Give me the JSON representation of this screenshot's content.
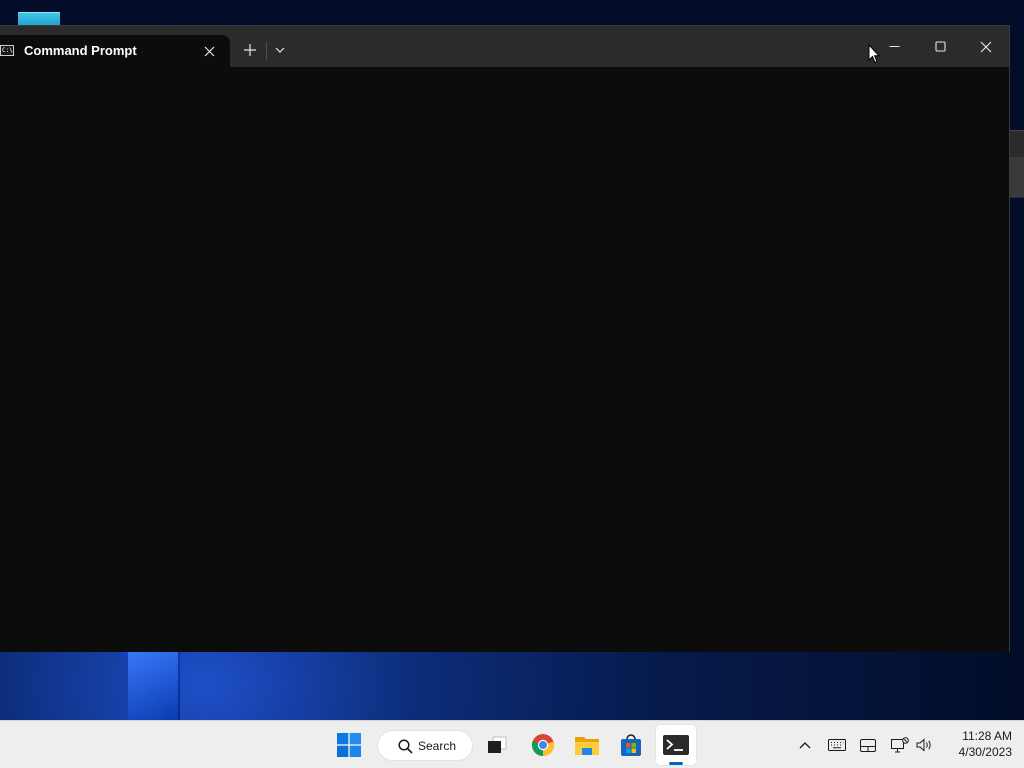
{
  "window": {
    "tab_title": "Command Prompt",
    "tab_icon_text": "C:\\."
  },
  "taskbar": {
    "search_label": "Search",
    "apps": [
      {
        "name": "start",
        "icon": "windows-logo-icon"
      },
      {
        "name": "search",
        "icon": "search-icon"
      },
      {
        "name": "task-view",
        "icon": "task-view-icon"
      },
      {
        "name": "chrome",
        "icon": "chrome-icon"
      },
      {
        "name": "file-explorer",
        "icon": "folder-icon"
      },
      {
        "name": "store",
        "icon": "store-icon"
      },
      {
        "name": "terminal",
        "icon": "terminal-icon",
        "active": true
      }
    ],
    "tray_icons": [
      "chevron-up-icon",
      "keyboard-icon",
      "tablet-icon",
      "network-icon",
      "volume-icon"
    ],
    "clock": {
      "time": "11:28 AM",
      "date": "4/30/2023"
    }
  },
  "colors": {
    "terminal_bg": "#0c0c0c",
    "titlebar_bg": "#2b2b2b",
    "taskbar_bg": "#eeeeee",
    "accent": "#0067c0"
  }
}
